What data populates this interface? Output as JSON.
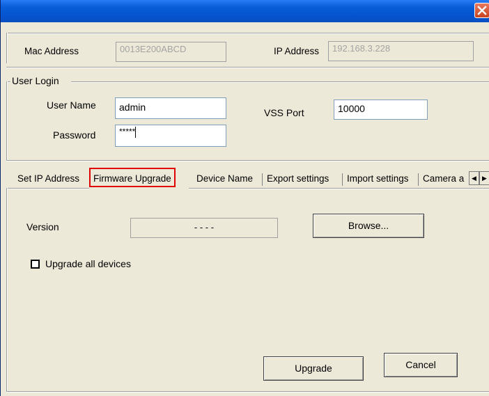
{
  "header": {
    "mac_label": "Mac Address",
    "mac_value": "0013E200ABCD",
    "ip_label": "IP Address",
    "ip_value": "192.168.3.228"
  },
  "login": {
    "group_label": "User Login",
    "username_label": "User Name",
    "username_value": "admin",
    "password_label": "Password",
    "password_value": "*****",
    "port_label": "VSS Port",
    "port_value": "10000"
  },
  "tabs": [
    {
      "label": "Set IP Address"
    },
    {
      "label": "Firmware Upgrade"
    },
    {
      "label": "Device Name"
    },
    {
      "label": "Export settings"
    },
    {
      "label": "Import settings"
    },
    {
      "label": "Camera a"
    }
  ],
  "firmware": {
    "version_label": "Version",
    "version_value": "- - - -",
    "browse_label": "Browse...",
    "upgrade_all_label": "Upgrade all devices",
    "upgrade_all_checked": false,
    "upgrade_label": "Upgrade",
    "cancel_label": "Cancel"
  },
  "icons": {
    "close": "close-icon",
    "scroll_left": "arrow-left-icon",
    "scroll_right": "arrow-right-icon"
  },
  "colors": {
    "titlebar": "#0553d0",
    "close_button": "#d4502c",
    "dialog_bg": "#ece9d8",
    "highlight": "#e00000"
  }
}
